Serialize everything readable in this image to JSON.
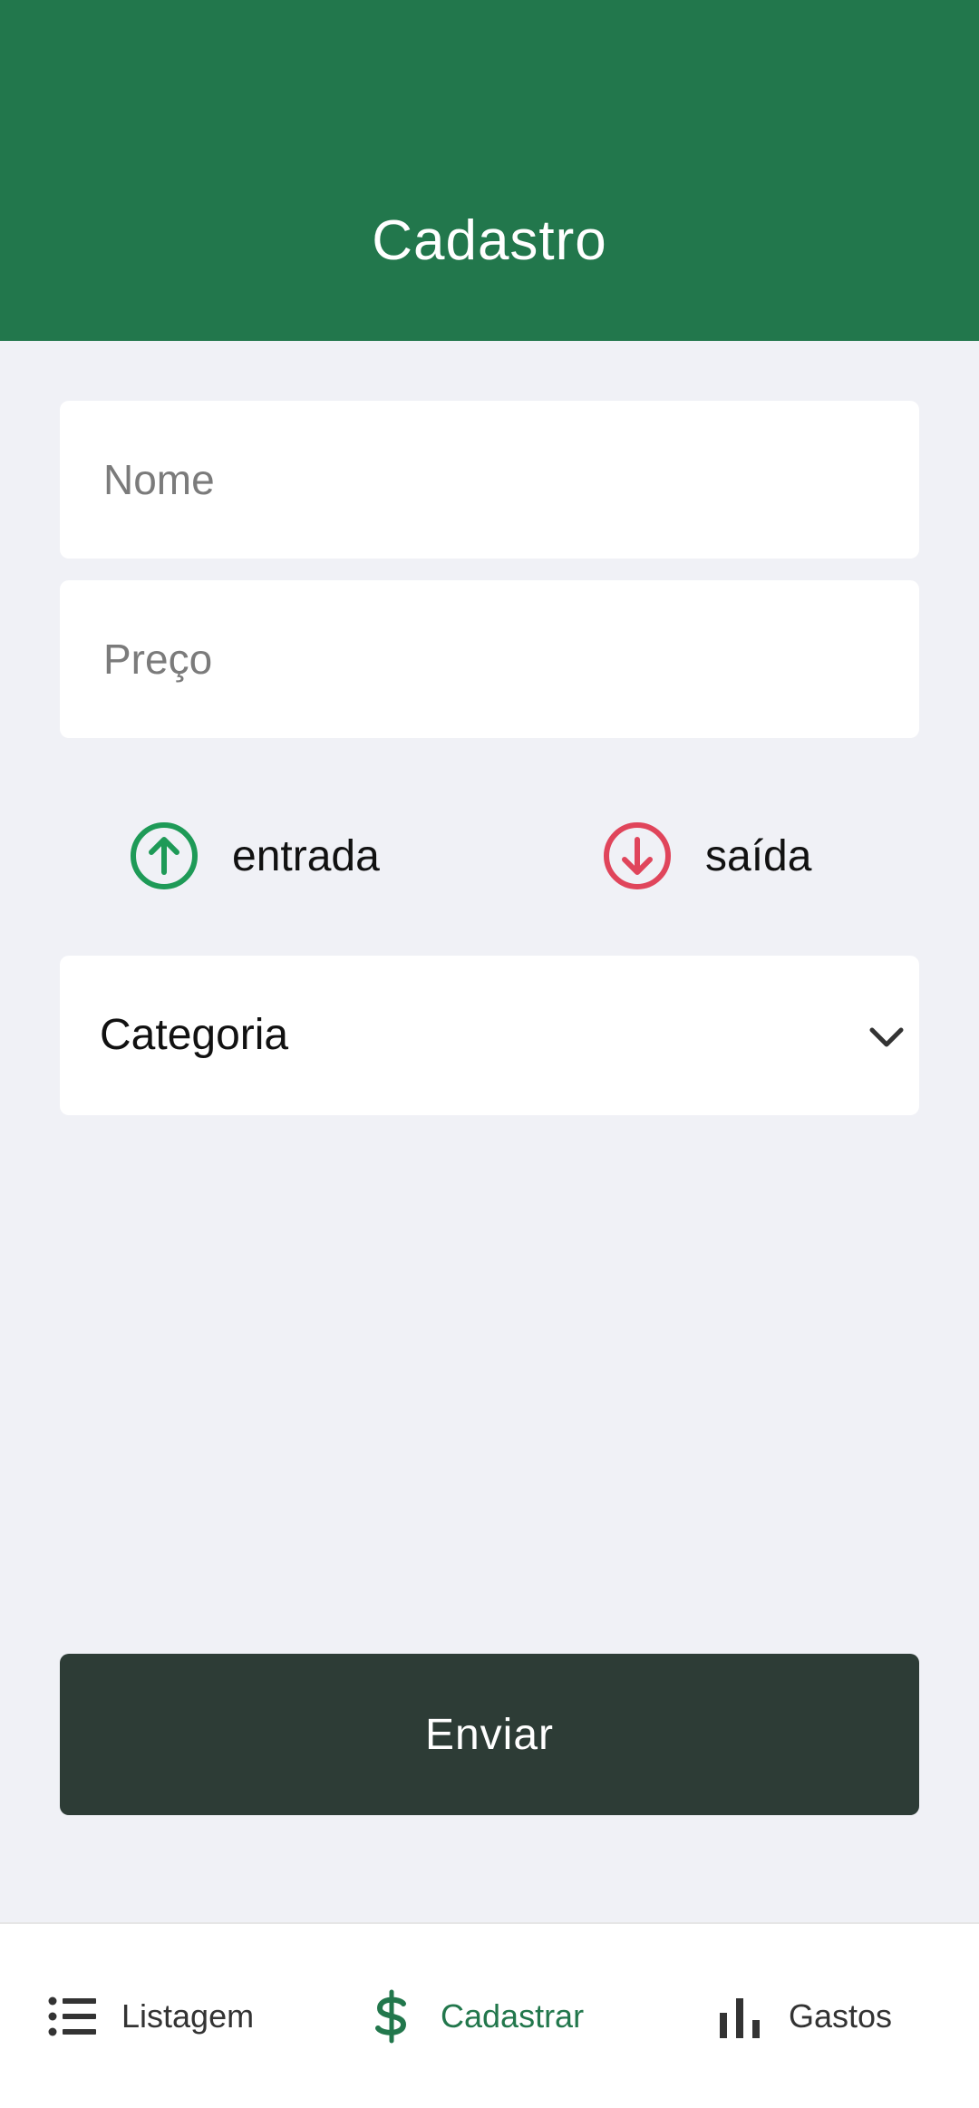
{
  "header": {
    "title": "Cadastro"
  },
  "form": {
    "name_placeholder": "Nome",
    "name_value": "",
    "price_placeholder": "Preço",
    "price_value": "",
    "type_options": [
      {
        "label": "entrada",
        "icon": "arrow-up-circle-icon",
        "color": "#1e9a57"
      },
      {
        "label": "saída",
        "icon": "arrow-down-circle-icon",
        "color": "#e0455b"
      }
    ],
    "category": {
      "value": "Categoria",
      "icon": "chevron-down-icon"
    },
    "submit_label": "Enviar"
  },
  "bottom_nav": {
    "items": [
      {
        "label": "Listagem",
        "icon": "list-icon",
        "active": false
      },
      {
        "label": "Cadastrar",
        "icon": "dollar-icon",
        "active": true
      },
      {
        "label": "Gastos",
        "icon": "bar-chart-icon",
        "active": false
      }
    ]
  },
  "colors": {
    "header": "#22774c",
    "background": "#f0f1f6",
    "button": "#2d3c36",
    "income": "#1e9a57",
    "expense": "#e0455b",
    "nav_active": "#22774c"
  }
}
